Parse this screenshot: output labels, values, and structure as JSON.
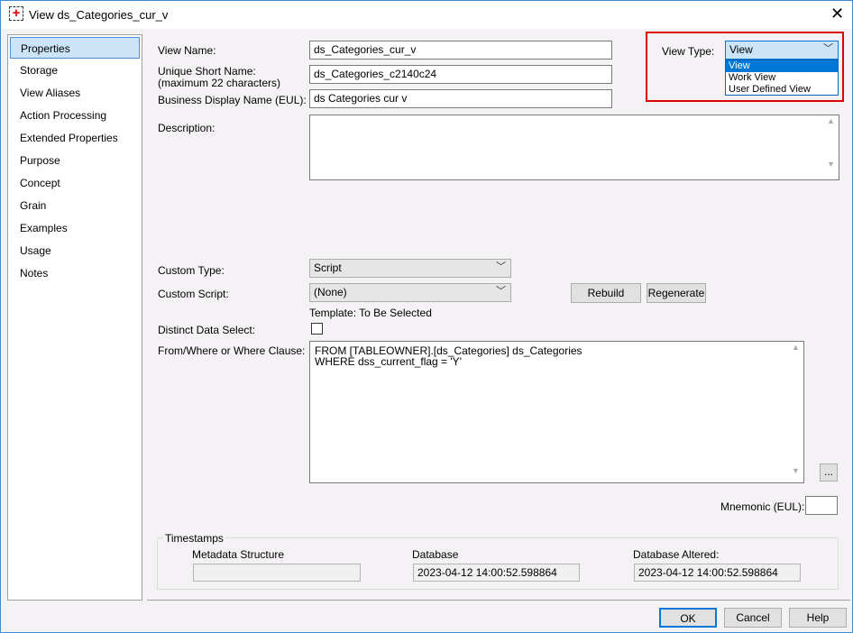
{
  "window": {
    "title": "View ds_Categories_cur_v",
    "close": "✕"
  },
  "nav": {
    "items": [
      "Properties",
      "Storage",
      "View Aliases",
      "Action Processing",
      "Extended Properties",
      "Purpose",
      "Concept",
      "Grain",
      "Examples",
      "Usage",
      "Notes"
    ]
  },
  "form": {
    "view_name_label": "View Name:",
    "view_name": "ds_Categories_cur_v",
    "short_name_label": "Unique Short Name:",
    "short_name_sub": "(maximum 22 characters)",
    "short_name": "ds_Categories_c2140c24",
    "business_label": "Business Display Name (EUL):",
    "business_name": "ds Categories cur v",
    "description_label": "Description:",
    "description": "",
    "custom_type_label": "Custom Type:",
    "custom_type": "Script",
    "custom_script_label": "Custom Script:",
    "custom_script": "(None)",
    "rebuild": "Rebuild",
    "regenerate": "Regenerate",
    "template": "Template: To Be Selected",
    "distinct_label": "Distinct Data Select:",
    "distinct_checked": false,
    "where_label": "From/Where or Where Clause:",
    "where_lines": [
      "FROM [TABLEOWNER].[ds_Categories] ds_Categories",
      "WHERE dss_current_flag = 'Y'"
    ],
    "ellipsis": "...",
    "mnemonic_label": "Mnemonic (EUL):",
    "mnemonic": ""
  },
  "view_type": {
    "label": "View Type:",
    "value": "View",
    "options": [
      "View",
      "Work View",
      "User Defined View"
    ],
    "selected": 0
  },
  "timestamps": {
    "title": "Timestamps",
    "metadata_label": "Metadata Structure",
    "metadata": "",
    "database_label": "Database",
    "database": "2023-04-12 14:00:52.598864",
    "altered_label": "Database Altered:",
    "altered": "2023-04-12 14:00:52.598864"
  },
  "buttons": {
    "ok": "OK",
    "cancel": "Cancel",
    "help": "Help"
  }
}
